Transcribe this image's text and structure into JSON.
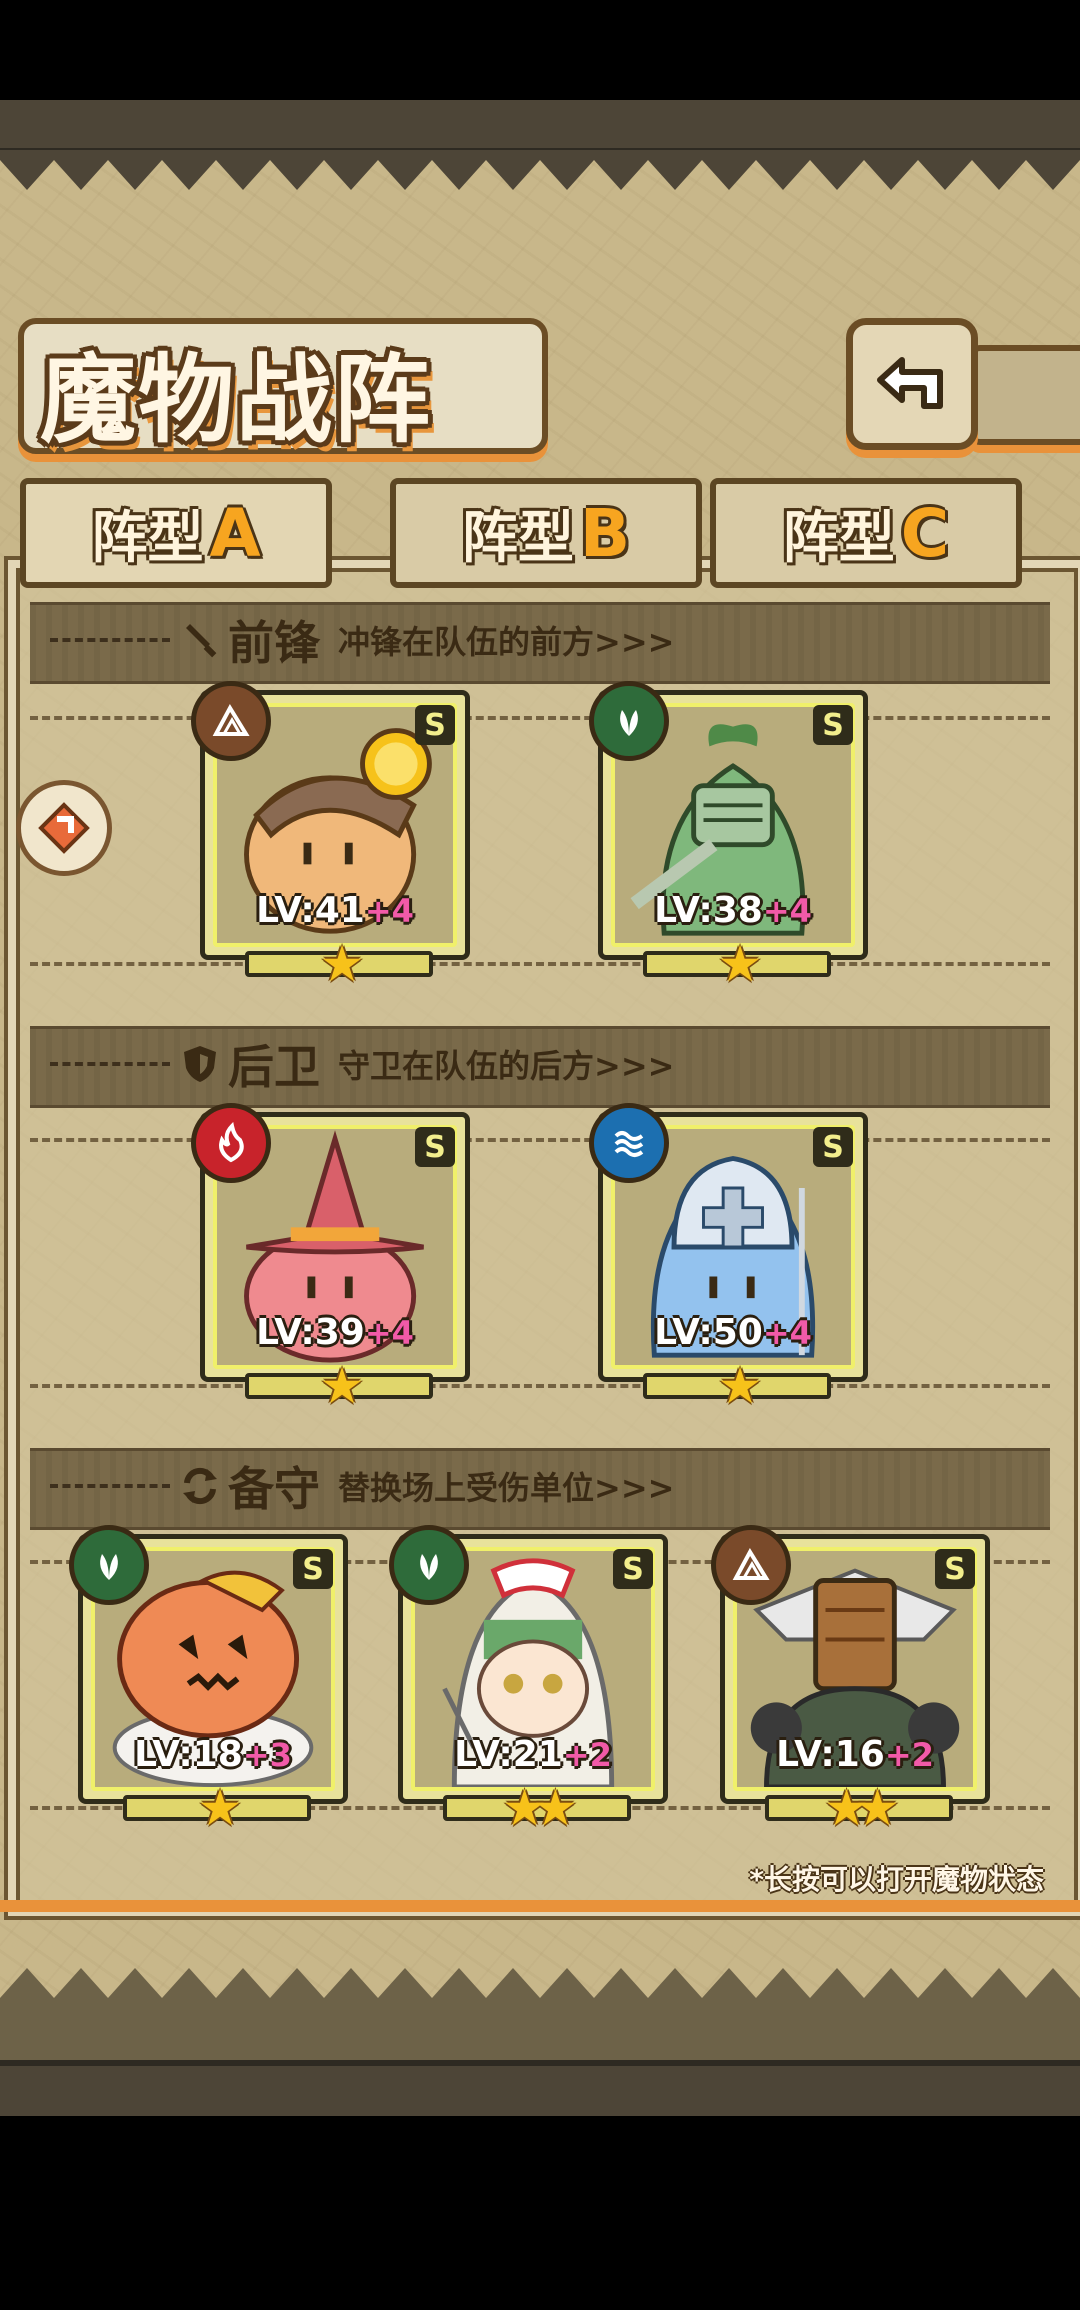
{
  "title": "魔物战阵",
  "tabs": [
    {
      "label": "阵型",
      "letter": "A",
      "active": true
    },
    {
      "label": "阵型",
      "letter": "B",
      "active": false
    },
    {
      "label": "阵型",
      "letter": "C",
      "active": false
    }
  ],
  "sections": {
    "front": {
      "title": "前锋",
      "subtitle": "冲锋在队伍的前方>>>",
      "icon": "sword-icon"
    },
    "rear": {
      "title": "后卫",
      "subtitle": "守卫在队伍的后方>>>",
      "icon": "shield-icon"
    },
    "reserve": {
      "title": "备守",
      "subtitle": "替换场上受伤单位>>>",
      "icon": "swap-icon"
    }
  },
  "units": {
    "front": [
      {
        "lv": "LV:41",
        "plus": "+4",
        "rank": "S",
        "stars": "★",
        "element": "rock",
        "color": "#f0b87a"
      },
      {
        "lv": "LV:38",
        "plus": "+4",
        "rank": "S",
        "stars": "★",
        "element": "leaf",
        "color": "#7fb87c"
      }
    ],
    "rear": [
      {
        "lv": "LV:39",
        "plus": "+4",
        "rank": "S",
        "stars": "★",
        "element": "fire",
        "color": "#ef8a8f"
      },
      {
        "lv": "LV:50",
        "plus": "+4",
        "rank": "S",
        "stars": "★",
        "element": "water",
        "color": "#93c2ee"
      }
    ],
    "reserve": [
      {
        "lv": "LV:18",
        "plus": "+3",
        "rank": "S",
        "stars": "★",
        "element": "leaf",
        "color": "#ef8a55"
      },
      {
        "lv": "LV:21",
        "plus": "+2",
        "rank": "S",
        "stars": "★★",
        "element": "leaf",
        "color": "#f2efe6"
      },
      {
        "lv": "LV:16",
        "plus": "+2",
        "rank": "S",
        "stars": "★★",
        "element": "rock",
        "color": "#8a7a62"
      }
    ]
  },
  "footnote": "*长按可以打开魔物状态",
  "colors": {
    "leaf": "#2e6b3a",
    "fire": "#c8232b",
    "water": "#1c6fb0",
    "rock": "#7a4a2a",
    "accent": "#e9923a"
  }
}
